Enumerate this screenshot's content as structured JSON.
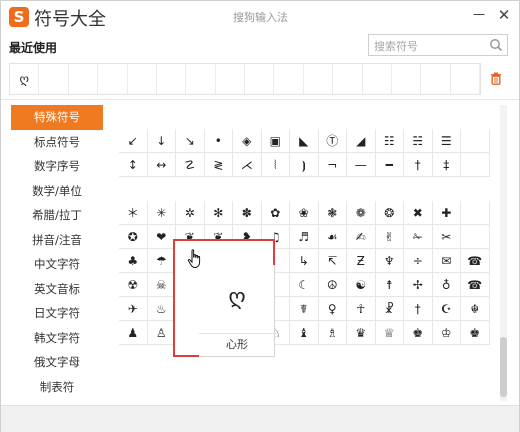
{
  "app": {
    "logo_letter": "S",
    "title": "符号大全",
    "window_caption": "搜狗输入法"
  },
  "window_controls": {
    "minimize": "－",
    "close": "✕"
  },
  "recent": {
    "title": "最近使用",
    "items": [
      "ღ",
      "",
      "",
      "",
      "",
      "",
      "",
      "",
      "",
      "",
      "",
      "",
      "",
      "",
      "",
      ""
    ]
  },
  "search": {
    "placeholder": "搜索符号",
    "value": ""
  },
  "sidebar": {
    "active_index": 0,
    "items": [
      {
        "label": "特殊符号"
      },
      {
        "label": "标点符号"
      },
      {
        "label": "数字序号"
      },
      {
        "label": "数学/单位"
      },
      {
        "label": "希腊/拉丁"
      },
      {
        "label": "拼音/注音"
      },
      {
        "label": "中文字符"
      },
      {
        "label": "英文音标"
      },
      {
        "label": "日文字符"
      },
      {
        "label": "韩文字符"
      },
      {
        "label": "俄文字母"
      },
      {
        "label": "制表符"
      }
    ]
  },
  "grid": {
    "rows": [
      [
        "",
        "",
        "",
        "",
        "",
        "",
        "",
        "",
        "",
        "",
        "",
        "",
        ""
      ],
      [
        "↙",
        "↓",
        "↘",
        "•",
        "◈",
        "▣",
        "◣",
        "Ⓣ",
        "◢",
        "☷",
        "☵",
        "☰",
        ""
      ],
      [
        "↕",
        "↔",
        "☡",
        "≷",
        "⋌",
        "⦚",
        "⦘",
        "¬",
        "—",
        "━",
        "†",
        "‡",
        ""
      ],
      [
        "",
        "",
        "",
        "",
        "",
        "",
        "",
        "",
        "",
        "",
        "",
        "",
        ""
      ],
      [
        "＊",
        "✳",
        "✲",
        "✻",
        "✽",
        "✿",
        "❀",
        "❃",
        "❁",
        "❂",
        "✖",
        "✚",
        ""
      ],
      [
        "✪",
        "❤",
        "❦",
        "❦",
        "❥",
        "♫",
        "♬",
        "☙",
        "✍",
        "✌",
        "✁",
        "✂",
        ""
      ],
      [
        "♣",
        "☂",
        "☺",
        "",
        "",
        "",
        "↳",
        "↸",
        "Ƶ",
        "♆",
        "÷",
        "✉",
        "☎"
      ],
      [
        "☢",
        "☠",
        "☃",
        "",
        "",
        "",
        "☾",
        "☮",
        "☯",
        "☨",
        "✢",
        "♁",
        "☎"
      ],
      [
        "✈",
        "♨",
        "☗",
        "",
        "",
        "",
        "☤",
        "♀",
        "☥",
        "☧",
        "†",
        "☪",
        "☬"
      ],
      [
        "♟",
        "♙",
        "♜",
        "♖",
        "♞",
        "♘",
        "♝",
        "♗",
        "♛",
        "♕",
        "♚",
        "♔",
        "♚"
      ]
    ]
  },
  "popup": {
    "symbol": "ღ",
    "name": "心形"
  },
  "colors": {
    "accent": "#f07a22",
    "highlight_border": "#e03c3c",
    "logo": "#ef6c1c"
  },
  "icons": [
    "search-icon",
    "trash-icon",
    "hand-cursor-icon"
  ]
}
